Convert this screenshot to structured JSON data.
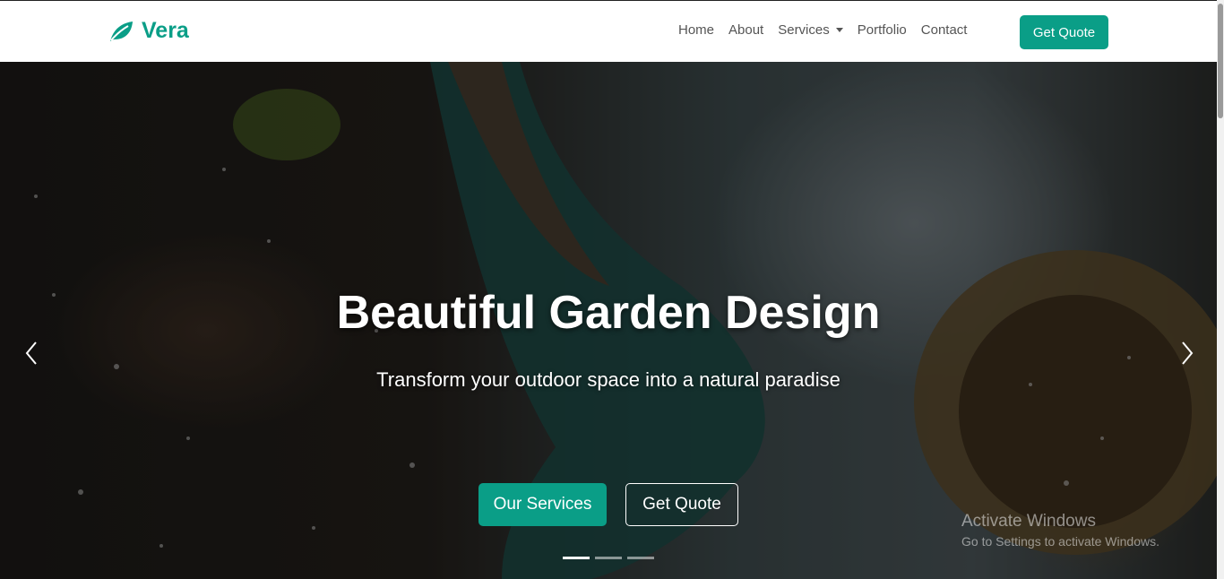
{
  "brand": {
    "name": "Vera",
    "icon": "leaf-icon",
    "color": "#0a9e87"
  },
  "nav": {
    "items": [
      {
        "label": "Home"
      },
      {
        "label": "About"
      },
      {
        "label": "Services",
        "has_dropdown": true
      },
      {
        "label": "Portfolio"
      },
      {
        "label": "Contact"
      }
    ],
    "cta_label": "Get Quote"
  },
  "hero": {
    "title": "Beautiful Garden Design",
    "subtitle": "Transform your outdoor space into a natural paradise",
    "primary_button": "Our Services",
    "secondary_button": "Get Quote",
    "slides_count": 3,
    "active_slide": 1,
    "prev_icon": "chevron-left-icon",
    "next_icon": "chevron-right-icon"
  },
  "watermark": {
    "title": "Activate Windows",
    "subtitle": "Go to Settings to activate Windows."
  },
  "colors": {
    "accent": "#0a9e87",
    "nav_text": "#555555"
  }
}
